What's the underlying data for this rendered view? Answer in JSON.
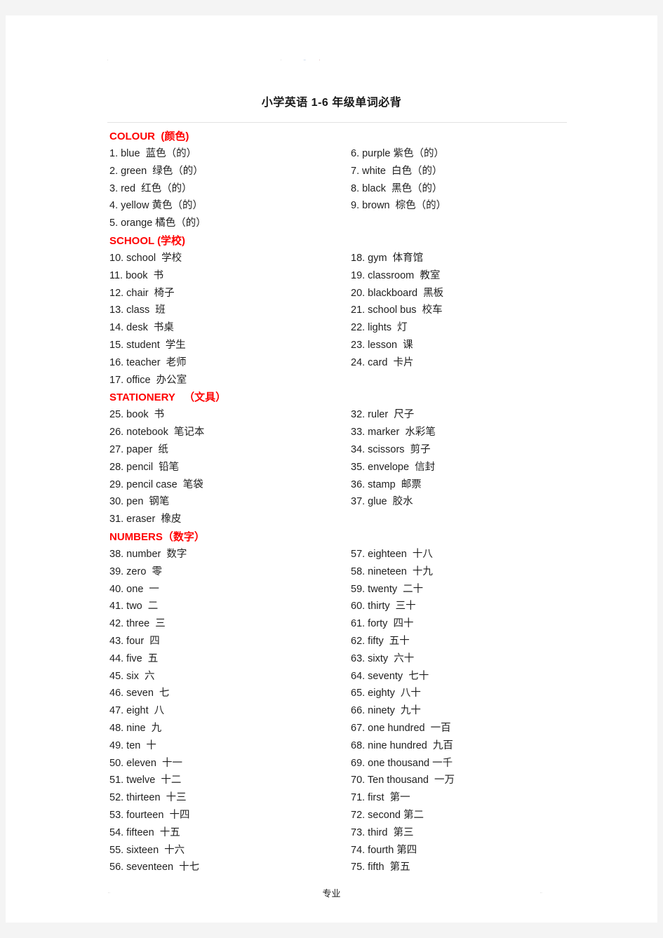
{
  "document": {
    "title": "小学英语 1-6 年级单词必背",
    "header_marks": {
      "left": ".",
      "mid": ".",
      "mid2": "..",
      "mid3": "."
    },
    "footer": {
      "center": "专业",
      "left_mark": "..",
      "right_mark": ".."
    },
    "accent_color": "#ff0000",
    "text_color": "#1f1f1f",
    "rule_color": "#e2e2e2"
  },
  "sections": [
    {
      "heading": "COLOUR  (颜色)",
      "left": [
        "1. blue  蓝色（的）",
        "2. green  绿色（的）",
        "3. red  红色（的）",
        "4. yellow 黄色（的）",
        "5. orange 橘色（的）"
      ],
      "right": [
        "6. purple 紫色（的）",
        "7. white  白色（的）",
        "8. black  黑色（的）",
        "9. brown  棕色（的）"
      ]
    },
    {
      "heading": "SCHOOL (学校)",
      "left": [
        "10. school  学校",
        "11. book  书",
        "12. chair  椅子",
        "13. class  班",
        "14. desk  书桌",
        "15. student  学生",
        "16. teacher  老师",
        "17. office  办公室"
      ],
      "right": [
        "18. gym  体育馆",
        "19. classroom  教室",
        "20. blackboard  黑板",
        "21. school bus  校车",
        "22. lights  灯",
        "23. lesson  课",
        "24. card  卡片"
      ]
    },
    {
      "heading": "STATIONERY   （文具）",
      "left": [
        "25. book  书",
        "26. notebook  笔记本",
        "27. paper  纸",
        "28. pencil  铅笔",
        "29. pencil case  笔袋",
        "30. pen  钢笔",
        "31. eraser  橡皮"
      ],
      "right": [
        "32. ruler  尺子",
        "33. marker  水彩笔",
        "34. scissors  剪子",
        "35. envelope  信封",
        "36. stamp  邮票",
        "37. glue  胶水"
      ]
    },
    {
      "heading": "NUMBERS（数字）",
      "left": [
        "38. number  数字",
        "39. zero  零",
        "40. one  一",
        "41. two  二",
        "42. three  三",
        "43. four  四",
        "44. five  五",
        "45. six  六",
        "46. seven  七",
        "47. eight  八",
        "48. nine  九",
        "49. ten  十",
        "50. eleven  十一",
        "51. twelve  十二",
        "52. thirteen  十三",
        "53. fourteen  十四",
        "54. fifteen  十五",
        "55. sixteen  十六",
        "56. seventeen  十七"
      ],
      "right": [
        "57. eighteen  十八",
        "58. nineteen  十九",
        "59. twenty  二十",
        "60. thirty  三十",
        "61. forty  四十",
        "62. fifty  五十",
        "63. sixty  六十",
        "64. seventy  七十",
        "65. eighty  八十",
        "66. ninety  九十",
        "67. one hundred  一百",
        "68. nine hundred  九百",
        "69. one thousand 一千",
        "70. Ten thousand  一万",
        "71. first  第一",
        "72. second 第二",
        "73. third  第三",
        "74. fourth 第四",
        "75. fifth  第五"
      ]
    }
  ]
}
